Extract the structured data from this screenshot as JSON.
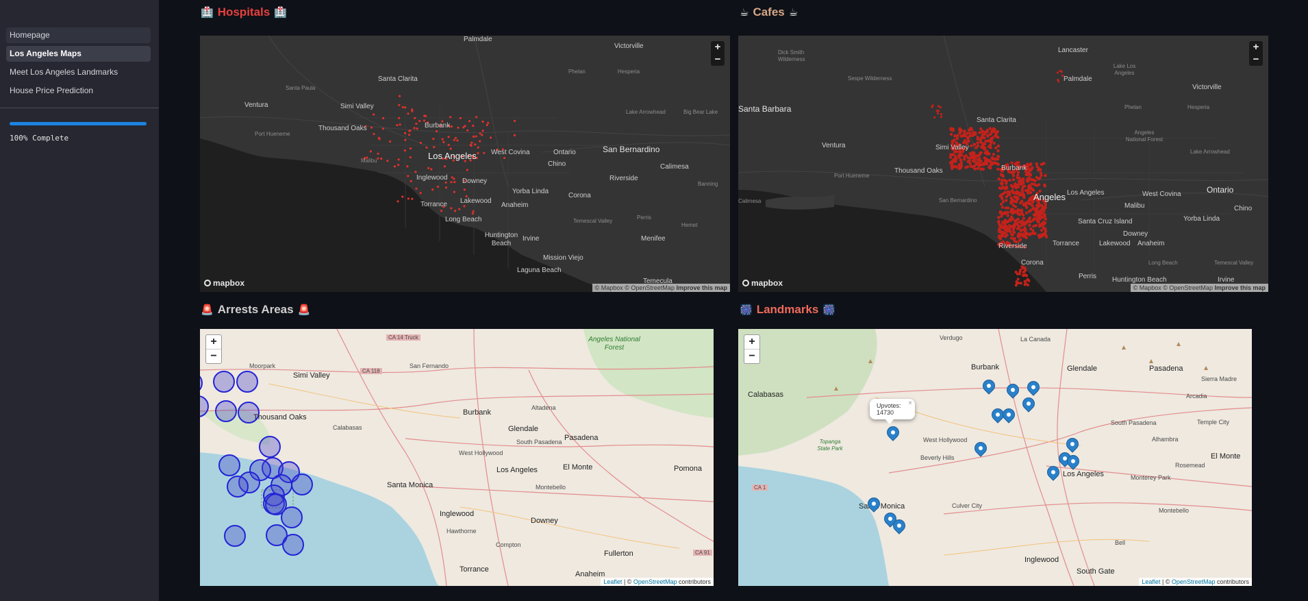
{
  "sidebar": {
    "nav": [
      {
        "label": "Homepage"
      },
      {
        "label": "Los Angeles Maps"
      },
      {
        "label": "Meet Los Angeles Landmarks"
      },
      {
        "label": "House Price Prediction"
      }
    ],
    "progress": {
      "value": 1.0,
      "text": "100% Complete"
    }
  },
  "sections": {
    "hospitals": {
      "emoji": "🏥",
      "title": "Hospitals"
    },
    "cafes": {
      "emoji": "☕",
      "title": "Cafes"
    },
    "arrests": {
      "emoji": "🚨",
      "title": "Arrests Areas"
    },
    "landmarks": {
      "emoji": "🎆",
      "title": "Landmarks"
    }
  },
  "maps": {
    "zoom_in": "+",
    "zoom_out": "−",
    "mapbox_logo": "mapbox",
    "mapbox_attrib": "© Mapbox © OpenStreetMap",
    "mapbox_improve": "Improve this map",
    "leaflet_link": "Leaflet",
    "leaflet_sep": " | © ",
    "osm_link": "OpenStreetMap",
    "leaflet_tail": " contributors",
    "hospital_places": [
      "Palmdale",
      "Victorville",
      "Santa Clarita",
      "Phelan",
      "Hesperia",
      "Santa Paula",
      "Simi Valley",
      "Lake Arrowhead",
      "Big Bear Lake",
      "Ventura",
      "Burbank",
      "Thousand Oaks",
      "Port Hueneme",
      "Los Angeles",
      "West Covina",
      "Ontario",
      "San Bernardino",
      "Malibu",
      "Chino",
      "Calimesa",
      "Inglewood",
      "Downey",
      "Riverside",
      "Yorba Linda",
      "Banning",
      "Torrance",
      "Lakewood",
      "Corona",
      "Anaheim",
      "Long Beach",
      "Temescal Valley",
      "Perris",
      "Hemet",
      "Huntington Beach",
      "Irvine",
      "Menifee",
      "Mission Viejo",
      "Laguna Beach",
      "Temecula",
      "Angeles National Forest",
      "Sespe Wilderness"
    ],
    "cafe_places": [
      "Lancaster",
      "Lake Los Angeles",
      "Palmdale",
      "Sespe Wilderness",
      "Dick Smith Wilderness",
      "Victorville",
      "Santa Clarita",
      "Phelan",
      "Hesperia",
      "Santa Barbara",
      "Ventura",
      "Simi Valley",
      "Angeles National Forest",
      "Lake Arrowhead",
      "Thousand Oaks",
      "Burbank",
      "Port Hueneme",
      "Los Angeles",
      "West Covina",
      "Ontario",
      "San Bernardino",
      "Malibu",
      "Chino",
      "Calimesa",
      "Santa Cruz Island",
      "Downey",
      "Yorba Linda",
      "Riverside",
      "Torrance",
      "Lakewood",
      "Anaheim",
      "Corona",
      "Long Beach",
      "Temescal Valley",
      "Perris",
      "Huntington Beach",
      "Irvine",
      "Menifee",
      "Angeles"
    ],
    "arrest_places": [
      "Angeles National Forest",
      "CA 14 Truck",
      "San Fernando",
      "Moorpark",
      "Simi Valley",
      "CA 118",
      "Thousand Oaks",
      "Calabasas",
      "Burbank",
      "Glendale",
      "Altadena",
      "Pasadena",
      "South Pasadena",
      "West Hollywood",
      "El Monte",
      "Santa Monica",
      "Los Angeles",
      "Montebello",
      "Inglewood",
      "Downey",
      "Pomona",
      "Hawthorne",
      "Compton",
      "Torrance",
      "Fullerton",
      "Anaheim",
      "CA 91"
    ],
    "landmark_places": [
      "Burbank",
      "Glendale",
      "Pasadena",
      "Sierra Madre",
      "Arcadia",
      "Calabasas",
      "West Hollywood",
      "Beverly Hills",
      "Alhambra",
      "El Monte",
      "Temple City",
      "Rosemead",
      "South Pasadena",
      "Los Angeles",
      "Monterey Park",
      "Santa Monica",
      "Culver City",
      "Montebello",
      "Inglewood",
      "South Gate",
      "Bell",
      "CA 1",
      "La Canada",
      "Verdugo",
      "Topanga State Park"
    ],
    "landmark_popup": {
      "label": "Upvotes:",
      "value": "14730"
    }
  }
}
